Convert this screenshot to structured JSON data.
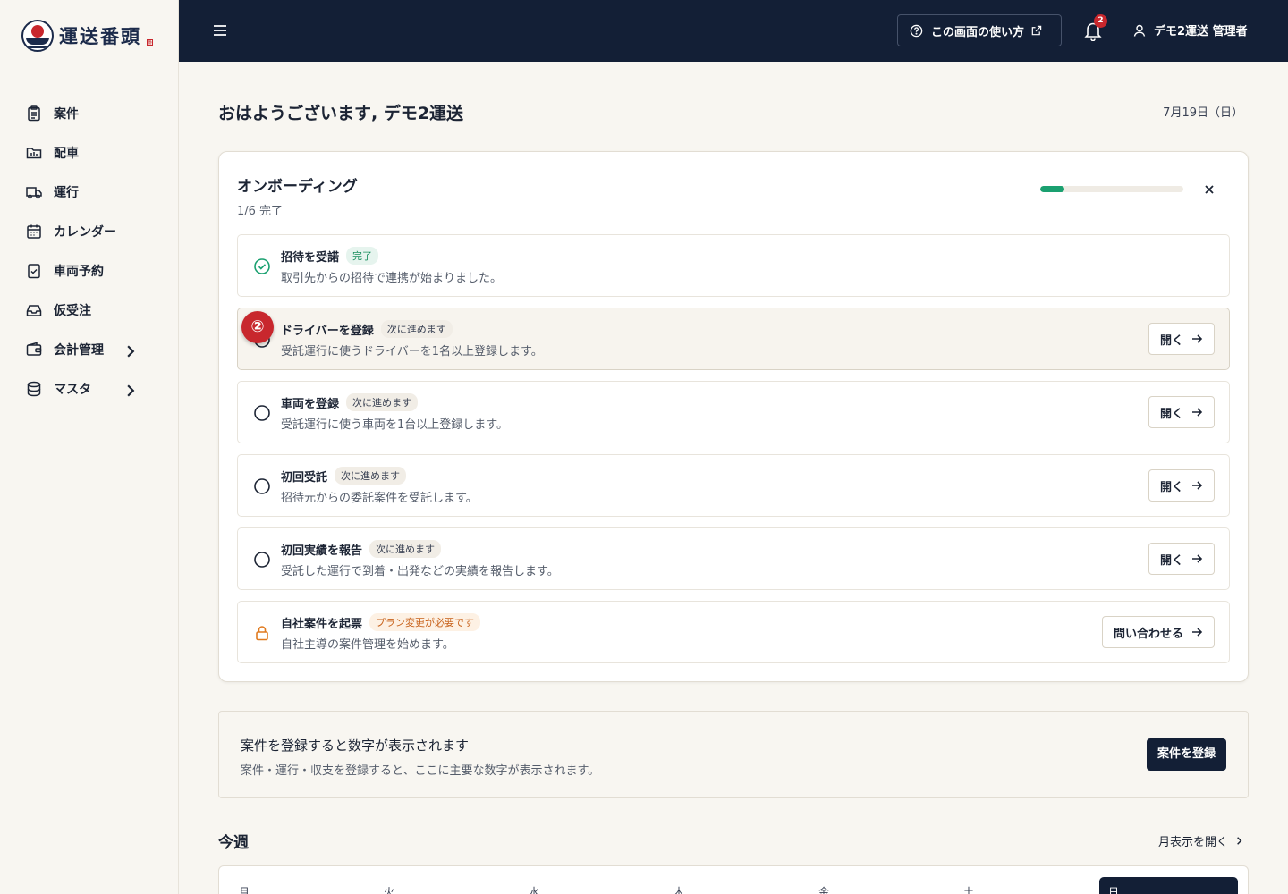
{
  "brand": {
    "name": "運送番頭",
    "seal": "番"
  },
  "sidebar": {
    "items": [
      {
        "label": "案件",
        "icon": "clipboard-icon"
      },
      {
        "label": "配車",
        "icon": "folder-icon"
      },
      {
        "label": "運行",
        "icon": "truck-icon"
      },
      {
        "label": "カレンダー",
        "icon": "calendar-icon"
      },
      {
        "label": "車両予約",
        "icon": "clipboard-check-icon"
      },
      {
        "label": "仮受注",
        "icon": "inbox-icon"
      },
      {
        "label": "会計管理",
        "icon": "wallet-icon",
        "expandable": true
      },
      {
        "label": "マスタ",
        "icon": "database-icon",
        "expandable": true
      }
    ]
  },
  "topbar": {
    "help_label": "この画面の使い方",
    "notification_count": "2",
    "user_label": "デモ2運送 管理者"
  },
  "main": {
    "greeting": "おはようございます, デモ2運送",
    "date": "7月19日（日）",
    "onboarding": {
      "title": "オンボーディング",
      "progress_text": "1/6 完了",
      "progress_fraction": 0.1667,
      "current_step_marker": "②",
      "steps": [
        {
          "title": "招待を受諾",
          "badge": "完了",
          "status": "done",
          "desc": "取引先からの招待で連携が始まりました。"
        },
        {
          "title": "ドライバーを登録",
          "badge": "次に進めます",
          "status": "next",
          "desc": "受託運行に使うドライバーを1名以上登録します。",
          "action": "開く"
        },
        {
          "title": "車両を登録",
          "badge": "次に進めます",
          "status": "next",
          "desc": "受託運行に使う車両を1台以上登録します。",
          "action": "開く"
        },
        {
          "title": "初回受託",
          "badge": "次に進めます",
          "status": "next",
          "desc": "招待元からの委託案件を受託します。",
          "action": "開く"
        },
        {
          "title": "初回実績を報告",
          "badge": "次に進めます",
          "status": "next",
          "desc": "受託した運行で到着・出発などの実績を報告します。",
          "action": "開く"
        },
        {
          "title": "自社案件を起票",
          "badge": "プラン変更が必要です",
          "status": "locked",
          "desc": "自社主導の案件管理を始めます。",
          "action": "問い合わせる"
        }
      ]
    },
    "empty_stats": {
      "title": "案件を登録すると数字が表示されます",
      "desc": "案件・運行・収支を登録すると、ここに主要な数字が表示されます。",
      "button": "案件を登録"
    },
    "week": {
      "title": "今週",
      "month_link": "月表示を開く",
      "days": [
        "月",
        "火",
        "水",
        "木",
        "金",
        "土",
        "日"
      ]
    }
  },
  "colors": {
    "navy": "#131f36",
    "accent_red": "#c8272d",
    "progress_green": "#1aa070",
    "lock_orange": "#e07a1f"
  }
}
